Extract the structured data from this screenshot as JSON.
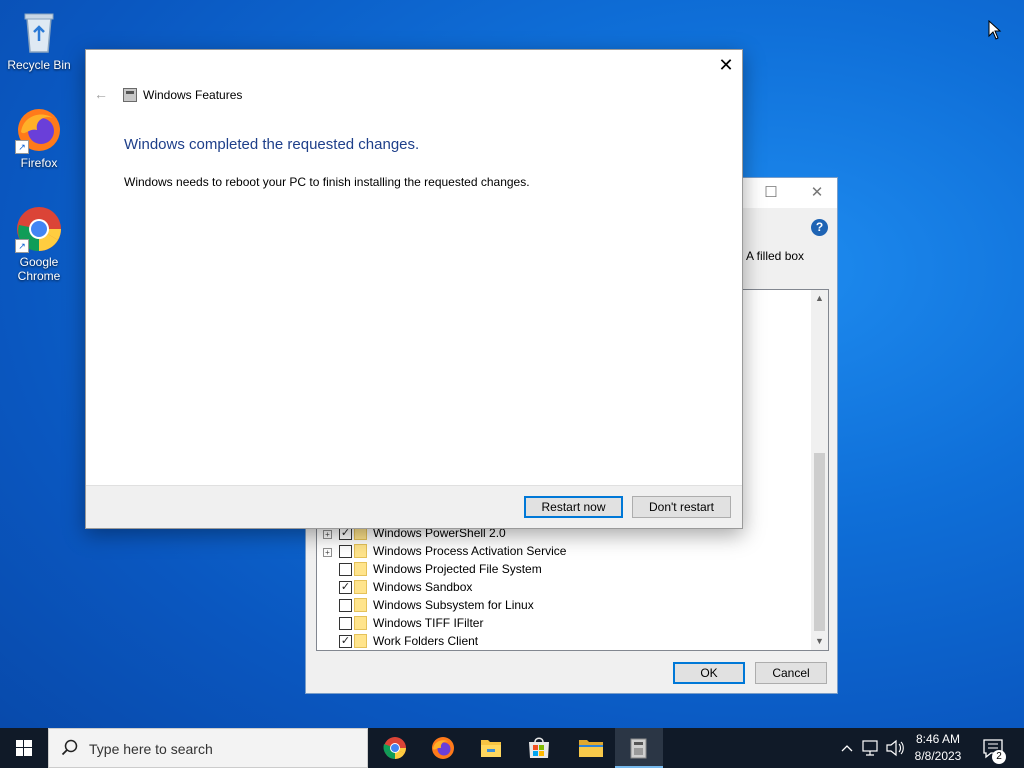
{
  "desktop": {
    "icons": [
      {
        "label": "Recycle Bin",
        "icon": "recycle-bin-icon"
      },
      {
        "label": "Firefox",
        "icon": "firefox-icon"
      },
      {
        "label": "Google Chrome",
        "icon": "chrome-icon"
      }
    ]
  },
  "back_dialog": {
    "description_fragment": "A filled box",
    "help_glyph": "?",
    "features": [
      {
        "label": "Windows PowerShell 2.0",
        "checked": true,
        "expandable": true
      },
      {
        "label": "Windows Process Activation Service",
        "checked": false,
        "expandable": true
      },
      {
        "label": "Windows Projected File System",
        "checked": false,
        "expandable": false
      },
      {
        "label": "Windows Sandbox",
        "checked": true,
        "expandable": false
      },
      {
        "label": "Windows Subsystem for Linux",
        "checked": false,
        "expandable": false
      },
      {
        "label": "Windows TIFF IFilter",
        "checked": false,
        "expandable": false
      },
      {
        "label": "Work Folders Client",
        "checked": true,
        "expandable": false
      }
    ],
    "ok_label": "OK",
    "cancel_label": "Cancel"
  },
  "front_dialog": {
    "title": "Windows Features",
    "heading": "Windows completed the requested changes.",
    "message": "Windows needs to reboot your PC to finish installing the requested changes.",
    "restart_label": "Restart now",
    "dont_restart_label": "Don't restart"
  },
  "taskbar": {
    "search_placeholder": "Type here to search",
    "pinned": [
      "chrome-icon",
      "firefox-icon",
      "file-explorer-icon",
      "store-icon",
      "folder-icon",
      "windows-features-icon"
    ],
    "time": "8:46 AM",
    "date": "8/8/2023",
    "notification_count": "2"
  },
  "colors": {
    "accent": "#0078d7",
    "heading_blue": "#1e3f8a",
    "taskbar": "#101a28"
  }
}
